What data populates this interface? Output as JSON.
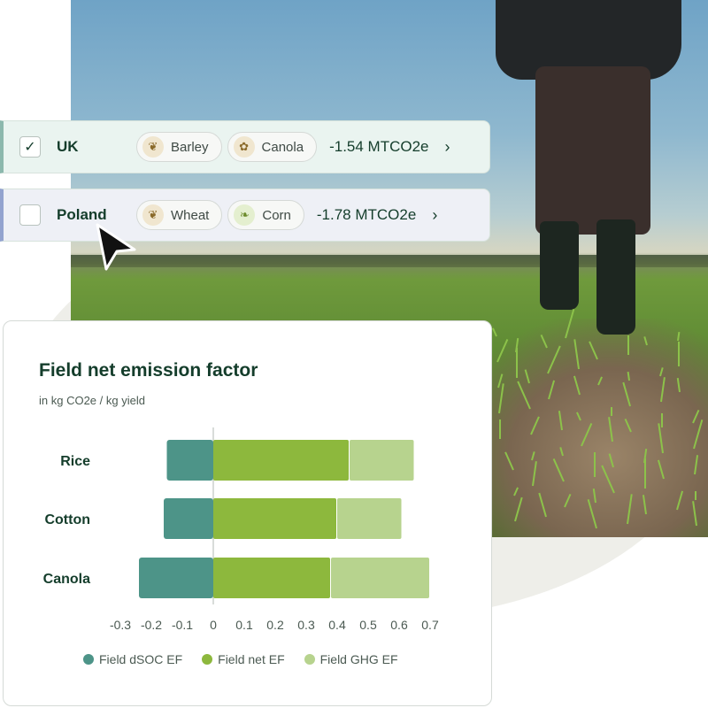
{
  "rows": [
    {
      "country": "UK",
      "checked": true,
      "check_mark": "✓",
      "crops": [
        "Barley",
        "Canola"
      ],
      "value": "-1.54 MTCO2e"
    },
    {
      "country": "Poland",
      "checked": false,
      "check_mark": "",
      "crops": [
        "Wheat",
        "Corn"
      ],
      "value": "-1.78 MTCO2e"
    }
  ],
  "chevron": "›",
  "chart": {
    "title": "Field net emission factor",
    "subtitle": "in kg CO2e / kg yield"
  },
  "colors": {
    "dsoc": "#4d9488",
    "net": "#8db83d",
    "ghg": "#b7d38e",
    "text_dark": "#143d2b"
  },
  "chart_data": {
    "type": "bar",
    "orientation": "horizontal",
    "stacked": true,
    "categories": [
      "Rice",
      "Cotton",
      "Canola"
    ],
    "series": [
      {
        "name": "Field dSOC EF",
        "values": [
          -0.15,
          -0.16,
          -0.24
        ]
      },
      {
        "name": "Field net EF",
        "values": [
          0.44,
          0.4,
          0.38
        ]
      },
      {
        "name": "Field GHG EF",
        "values": [
          0.21,
          0.21,
          0.32
        ]
      }
    ],
    "xlim": [
      -0.3,
      0.7
    ],
    "xticks": [
      "-0.3",
      "-0.2",
      "-0.1",
      "0",
      "0.1",
      "0.2",
      "0.3",
      "0.4",
      "0.5",
      "0.6",
      "0.7"
    ],
    "legend_position": "bottom",
    "grid": false
  }
}
